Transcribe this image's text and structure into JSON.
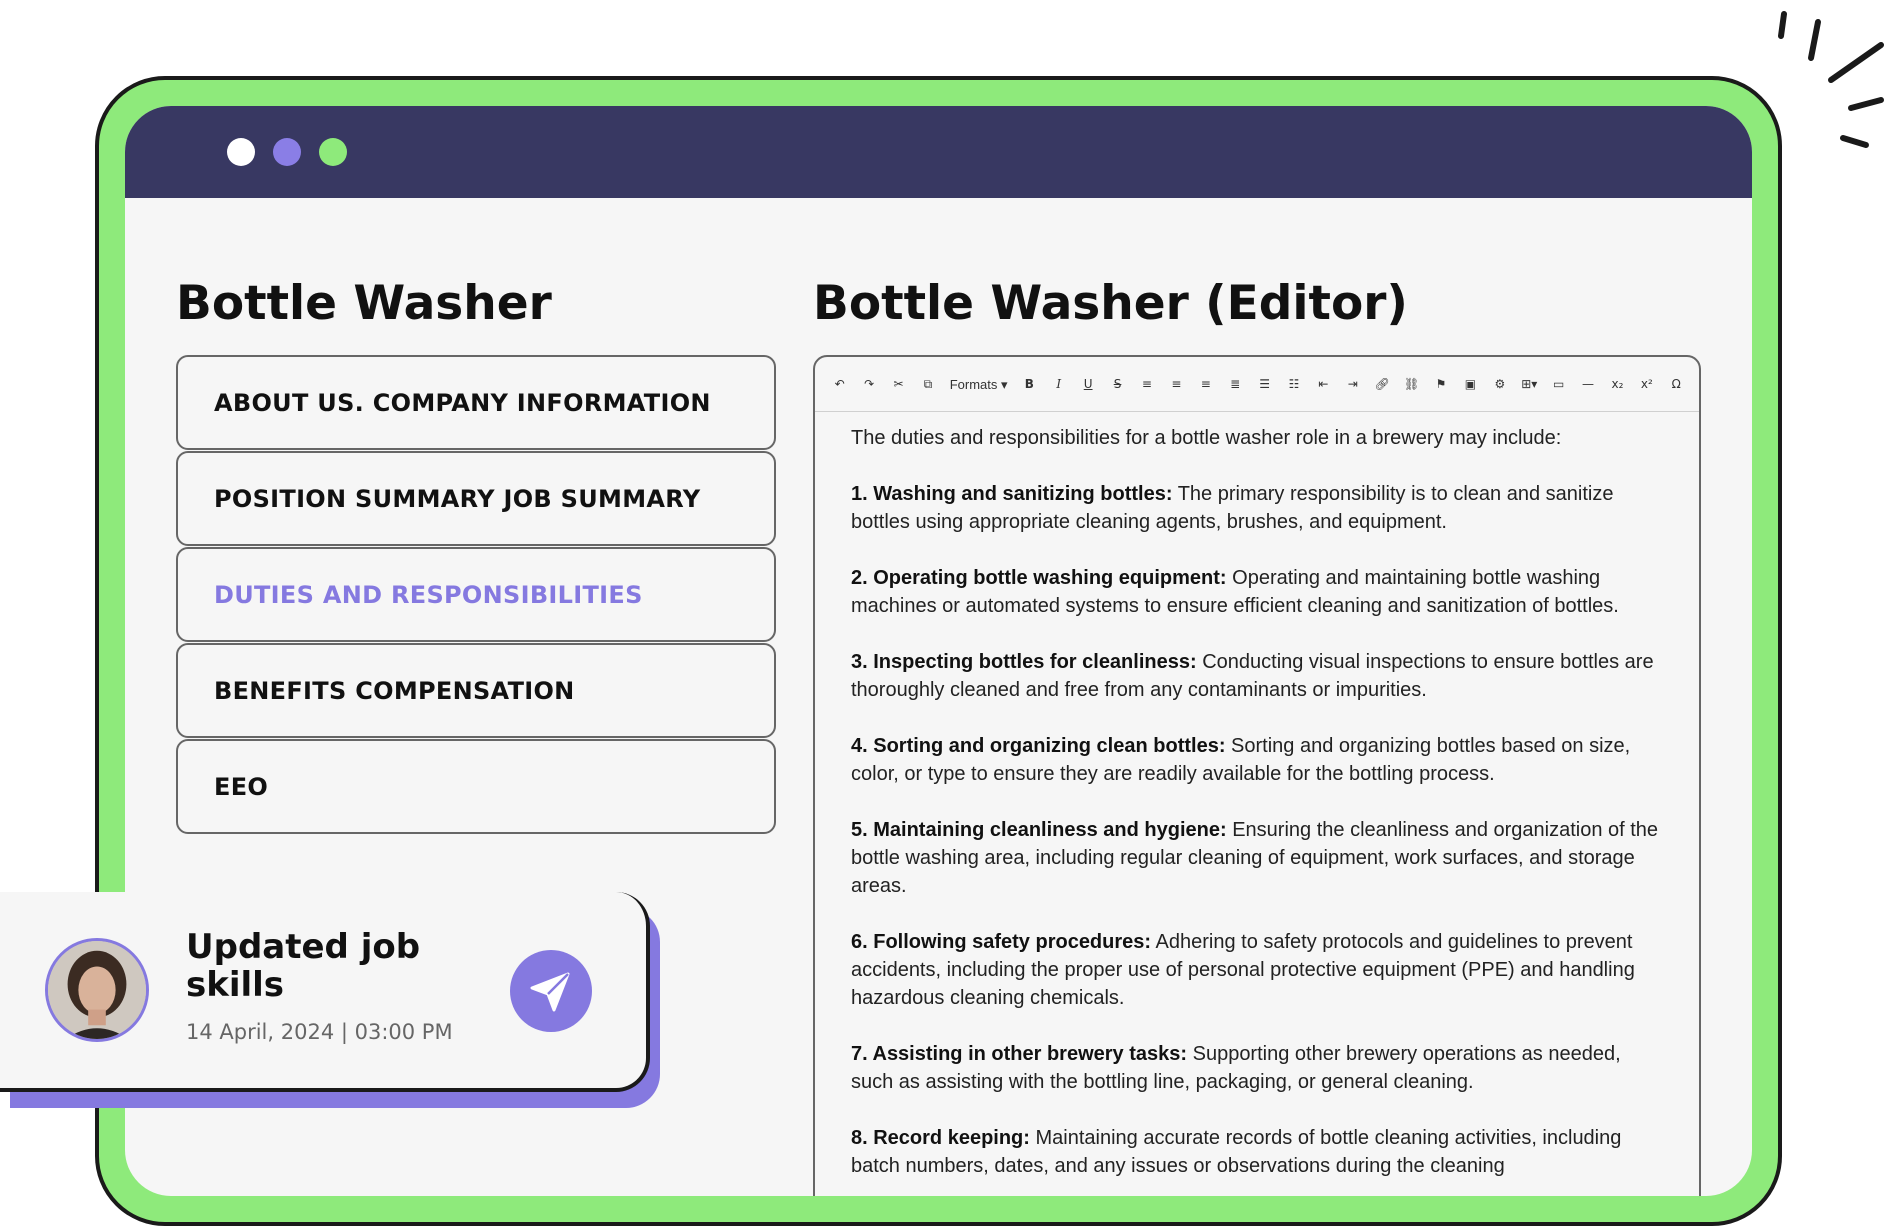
{
  "left": {
    "title": "Bottle Washer",
    "sections": [
      {
        "label": "ABOUT US. COMPANY INFORMATION"
      },
      {
        "label": "POSITION SUMMARY JOB SUMMARY"
      },
      {
        "label": "DUTIES AND RESPONSIBILITIES",
        "active": true
      },
      {
        "label": "BENEFITS COMPENSATION"
      },
      {
        "label": "EEO"
      }
    ]
  },
  "editor": {
    "title": "Bottle Washer (Editor)",
    "toolbar": {
      "formats_label": "Formats ▾",
      "icons": [
        "undo-icon",
        "redo-icon",
        "cut-icon",
        "copy-icon",
        "bold-icon",
        "italic-icon",
        "underline-icon",
        "strikethrough-icon",
        "align-left-icon",
        "align-center-icon",
        "align-right-icon",
        "justify-icon",
        "bullet-list-icon",
        "numbered-list-icon",
        "outdent-icon",
        "indent-icon",
        "link-icon",
        "unlink-icon",
        "bookmark-icon",
        "image-icon",
        "media-icon",
        "table-icon",
        "preview-icon",
        "horizontal-rule-icon",
        "subscript-icon",
        "superscript-icon",
        "special-char-icon"
      ]
    },
    "intro": "The duties and responsibilities for a bottle washer role in a brewery may include:",
    "items": [
      {
        "heading": "1. Washing and sanitizing bottles:",
        "text": " The primary responsibility is to clean and sanitize bottles using appropriate cleaning agents, brushes, and equipment."
      },
      {
        "heading": "2. Operating bottle washing equipment:",
        "text": " Operating and maintaining bottle washing machines or automated systems to ensure efficient cleaning and sanitization of bottles."
      },
      {
        "heading": "3. Inspecting bottles for cleanliness:",
        "text": " Conducting visual inspections to ensure bottles are thoroughly cleaned and free from any contaminants or impurities."
      },
      {
        "heading": "4. Sorting and organizing clean bottles:",
        "text": " Sorting and organizing bottles based on size, color, or type to ensure they are readily available for the bottling process."
      },
      {
        "heading": "5. Maintaining cleanliness and hygiene:",
        "text": " Ensuring the cleanliness and organization of the bottle washing area, including regular cleaning of equipment, work surfaces, and storage areas."
      },
      {
        "heading": "6. Following safety procedures:",
        "text": " Adhering to safety protocols and guidelines to prevent accidents, including the proper use of personal protective equipment (PPE) and handling hazardous cleaning chemicals."
      },
      {
        "heading": "7. Assisting in other brewery tasks:",
        "text": " Supporting other brewery operations as needed, such as assisting with the bottling line, packaging, or general cleaning."
      },
      {
        "heading": "8. Record keeping:",
        "text": " Maintaining accurate records of bottle cleaning activities, including batch numbers, dates, and any issues or observations during the cleaning"
      }
    ]
  },
  "notification": {
    "title": "Updated job skills",
    "date": "14 April, 2024 | 03:00 PM"
  },
  "colors": {
    "frame": "#8eea7b",
    "titlebar": "#383862",
    "accent": "#8579e0",
    "page_bg": "#f6f6f6"
  }
}
